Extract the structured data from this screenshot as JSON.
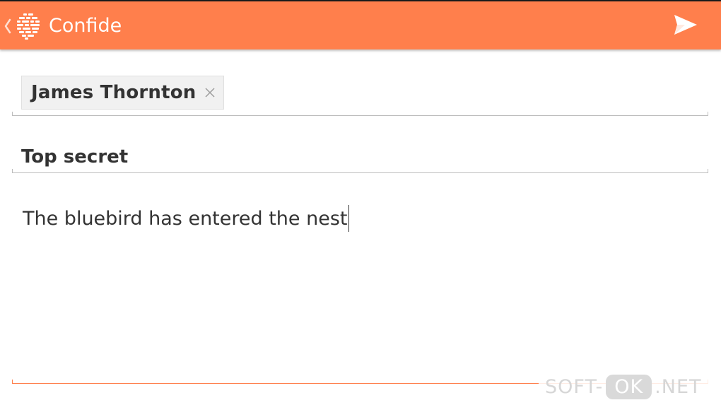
{
  "app": {
    "title": "Confide",
    "accent_color": "#ff7f4c",
    "icons": {
      "back": "chevron-left-icon",
      "logo": "confide-logo-icon",
      "send": "send-icon",
      "remove": "close-icon"
    }
  },
  "compose": {
    "recipient": {
      "name": "James Thornton"
    },
    "subject": "Top secret",
    "message": "The bluebird has entered the nest"
  },
  "watermark": {
    "left": "SOFT-",
    "pill": "OK",
    "right": ".NET"
  }
}
